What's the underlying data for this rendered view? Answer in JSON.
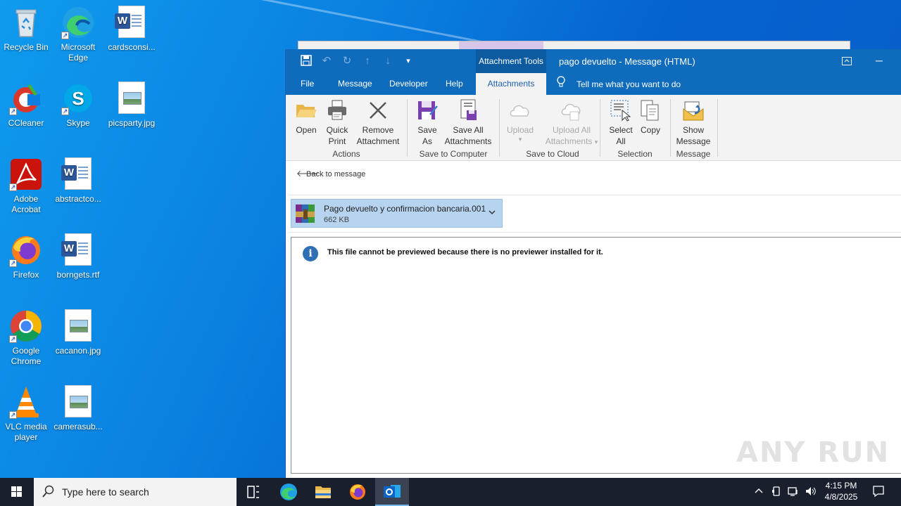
{
  "desktop": {
    "icons": [
      {
        "label": "Recycle Bin"
      },
      {
        "label": "Microsoft Edge"
      },
      {
        "label": "cardsconsi..."
      },
      {
        "label": "CCleaner"
      },
      {
        "label": "Skype"
      },
      {
        "label": "picsparty.jpg"
      },
      {
        "label": "Adobe Acrobat"
      },
      {
        "label": "abstractco..."
      },
      {
        "label": "Firefox"
      },
      {
        "label": "borngets.rtf"
      },
      {
        "label": "Google Chrome"
      },
      {
        "label": "cacanon.jpg"
      },
      {
        "label": "VLC media player"
      },
      {
        "label": "camerasub..."
      }
    ]
  },
  "window": {
    "context_tab": "Attachment Tools",
    "title": "pago devuelto  -  Message (HTML)",
    "qat_icons": [
      "save-icon",
      "undo-icon",
      "redo-icon",
      "up-arrow-icon",
      "down-arrow-icon",
      "customize-qat-icon"
    ]
  },
  "tabs": {
    "file": "File",
    "message": "Message",
    "developer": "Developer",
    "help": "Help",
    "attachments": "Attachments",
    "tell_me": "Tell me what you want to do"
  },
  "ribbon": {
    "open": "Open",
    "quick_print_1": "Quick",
    "quick_print_2": "Print",
    "remove_1": "Remove",
    "remove_2": "Attachment",
    "save_as_1": "Save",
    "save_as_2": "As",
    "save_all_1": "Save All",
    "save_all_2": "Attachments",
    "upload_1": "Upload",
    "upload_all_1": "Upload All",
    "upload_all_2": "Attachments",
    "select_all_1": "Select",
    "select_all_2": "All",
    "copy": "Copy",
    "show_msg_1": "Show",
    "show_msg_2": "Message",
    "groups": {
      "actions": "Actions",
      "save_to_computer": "Save to Computer",
      "save_to_cloud": "Save to Cloud",
      "selection": "Selection",
      "message": "Message"
    }
  },
  "content": {
    "back_link": "Back to message",
    "attachment": {
      "name": "Pago devuelto y confirmacion bancaria.001",
      "size": "662 KB"
    },
    "preview_message": "This file cannot be previewed because there is no previewer installed for it.",
    "watermark": "ANY RUN"
  },
  "taskbar": {
    "search_placeholder": "Type here to search",
    "time": "4:15 PM",
    "date": "4/8/2025"
  },
  "colors": {
    "titlebar": "#0f6cbd",
    "ribbon_bg": "#f3f3f3",
    "attachment_chip": "#b6d3ef",
    "taskbar": "#1a1f2e"
  }
}
